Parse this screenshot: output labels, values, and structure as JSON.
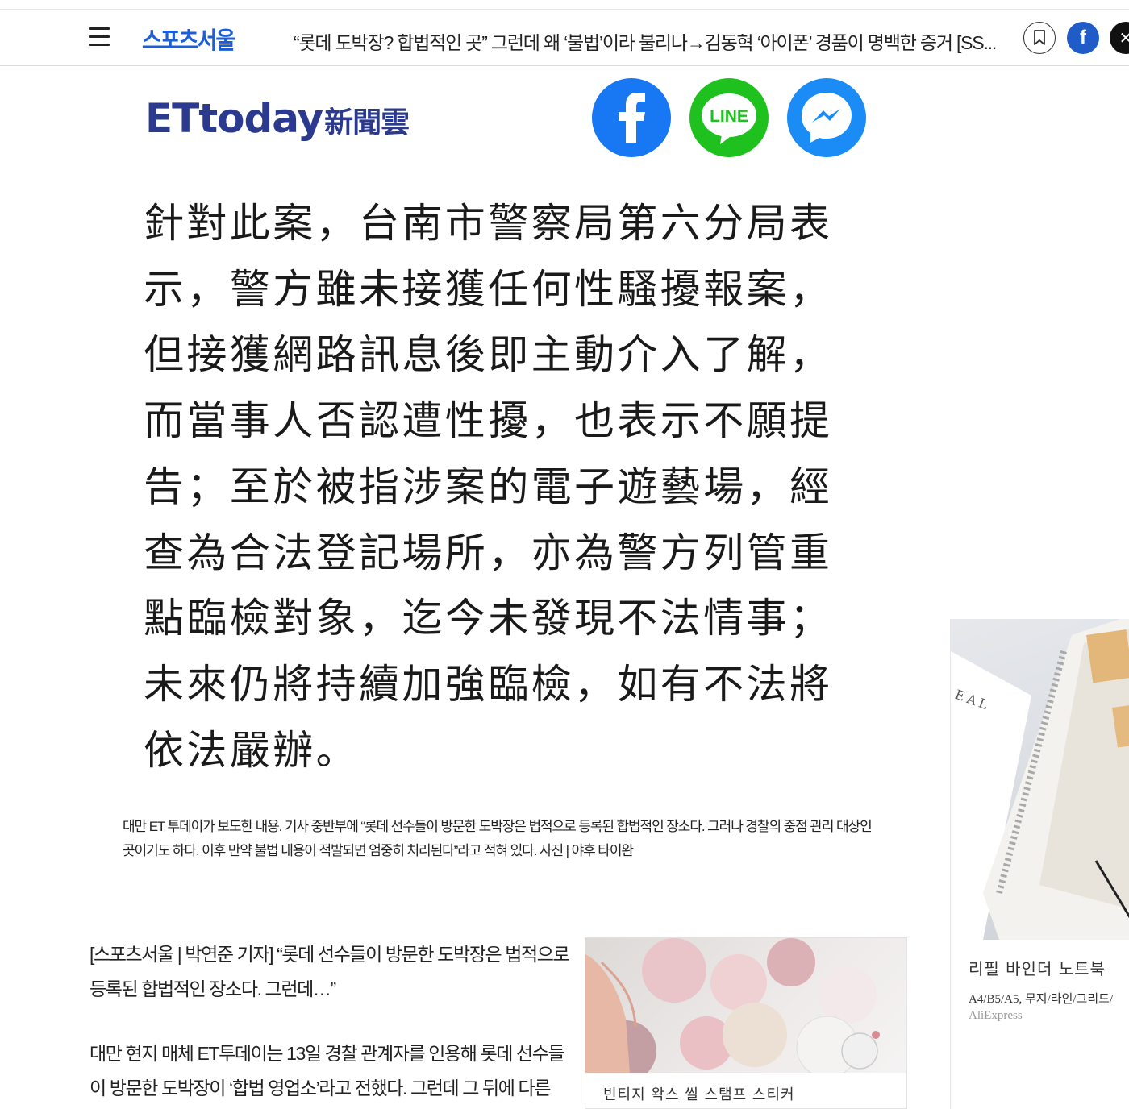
{
  "header": {
    "logo": "스포츠서울",
    "headline": "“롯데 도박장? 합법적인 곳” 그런데 왜 ‘불법’이라 불리나→김동혁 ‘아이폰’ 경품이 명백한 증거 [SS...",
    "icons": {
      "menu": "hamburger-menu-icon",
      "bookmark": "bookmark-icon",
      "facebook": "facebook-icon",
      "x": "x-twitter-icon"
    }
  },
  "embed": {
    "logo_latin": "ETtoday",
    "logo_chinese": "新聞雲",
    "share": {
      "facebook": "f",
      "line": "LINE",
      "messenger": "messenger-icon"
    },
    "lines": [
      "針對此案，台南市警察局第六分局表",
      "示，警方雖未接獲任何性騷擾報案，",
      "但接獲網路訊息後即主動介入了解，",
      "而當事人否認遭性擾，也表示不願提",
      "告；至於被指涉案的電子遊藝場，經",
      "查為合法登記場所，亦為警方列管重",
      "點臨檢對象，迄今未發現不法情事；",
      "未來仍將持續加強臨檢，如有不法將",
      "依法嚴辦。"
    ]
  },
  "caption": "대만 ET 투데이가 보도한 내용. 기사 중반부에 “롯데 선수들이 방문한 도박장은 법적으로 등록된 합법적인 장소다. 그러나 경찰의 중점 관리 대상인 곳이기도 하다. 이후 만약 불법 내용이 적발되면 엄중히 처리된다”라고 적혀 있다. 사진 | 야후 타이완",
  "article": {
    "paragraphs": [
      "[스포츠서울 | 박연준 기자] “롯데 선수들이 방문한 도박장은 법적으로 등록된 합법적인 장소다. 그런데…”",
      "대만 현지 매체 ET투데이는 13일 경찰 관계자를 인용해 롯데 선수들이 방문한 도박장이 ‘합법 영업소’라고 전했다. 그런데 그 뒤에 다른"
    ]
  },
  "ad_inline": {
    "title": "빈티지 왁스 씰 스탬프 스티커"
  },
  "ad_right": {
    "title": "리필 바인더 노트북",
    "subtitle": "A4/B5/A5, 무지/라인/그리드/",
    "source": "AliExpress",
    "paper_text": "EAL"
  }
}
